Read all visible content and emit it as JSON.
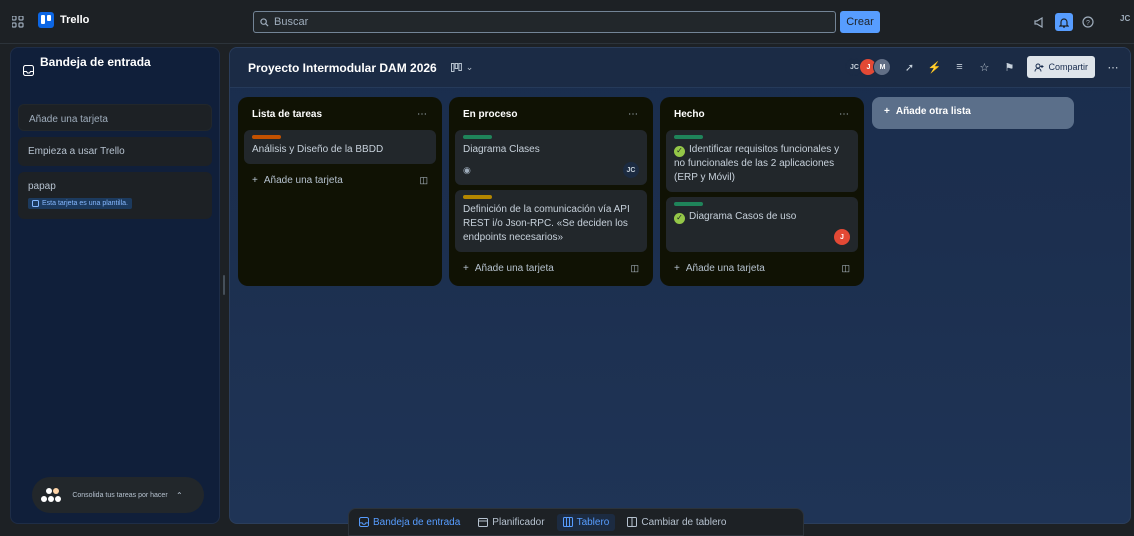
{
  "topbar": {
    "app_name": "Trello",
    "search_placeholder": "Buscar",
    "create_label": "Crear",
    "avatar_initials": "JC"
  },
  "sidebar": {
    "title": "Bandeja de entrada",
    "add_card_placeholder": "Añade una tarjeta",
    "cards": [
      {
        "title": "Empieza a usar Trello"
      },
      {
        "title": "papap",
        "badge": "Esta tarjeta es una plantilla."
      }
    ],
    "consolidate_text": "Consolida tus tareas por hacer"
  },
  "board": {
    "title": "Proyecto Intermodular DAM 2026",
    "members": [
      "JC",
      "J",
      "M"
    ],
    "share_label": "Compartir",
    "add_list_label": "Añade otra lista",
    "lists": [
      {
        "title": "Lista de tareas",
        "add_card_label": "Añade una tarjeta",
        "cards": [
          {
            "label_color": "#c25100",
            "text": "Análisis y Diseño de la BBDD"
          }
        ]
      },
      {
        "title": "En proceso",
        "add_card_label": "Añade una tarjeta",
        "cards": [
          {
            "label_color": "#1f845a",
            "text": "Diagrama Clases",
            "member": "JC"
          },
          {
            "label_color": "#b38600",
            "text": "Definición de la comunicación vía API REST i/o Json-RPC. «Se deciden los endpoints necesarios»"
          }
        ]
      },
      {
        "title": "Hecho",
        "add_card_label": "Añade una tarjeta",
        "cards": [
          {
            "label_color": "#1f845a",
            "text": "Identificar requisitos funcionales y no funcionales de las 2 aplicaciones (ERP y Móvil)",
            "complete": true
          },
          {
            "label_color": "#1f845a",
            "text": "Diagrama Casos de uso",
            "complete": true,
            "member": "J"
          }
        ]
      }
    ]
  },
  "bottom_nav": {
    "items": [
      "Bandeja de entrada",
      "Planificador",
      "Tablero",
      "Cambiar de tablero"
    ]
  },
  "colors": {
    "accent": "#579dff",
    "list_bg": "#101204",
    "card_bg": "#22272b",
    "member_j": "#e34935"
  }
}
